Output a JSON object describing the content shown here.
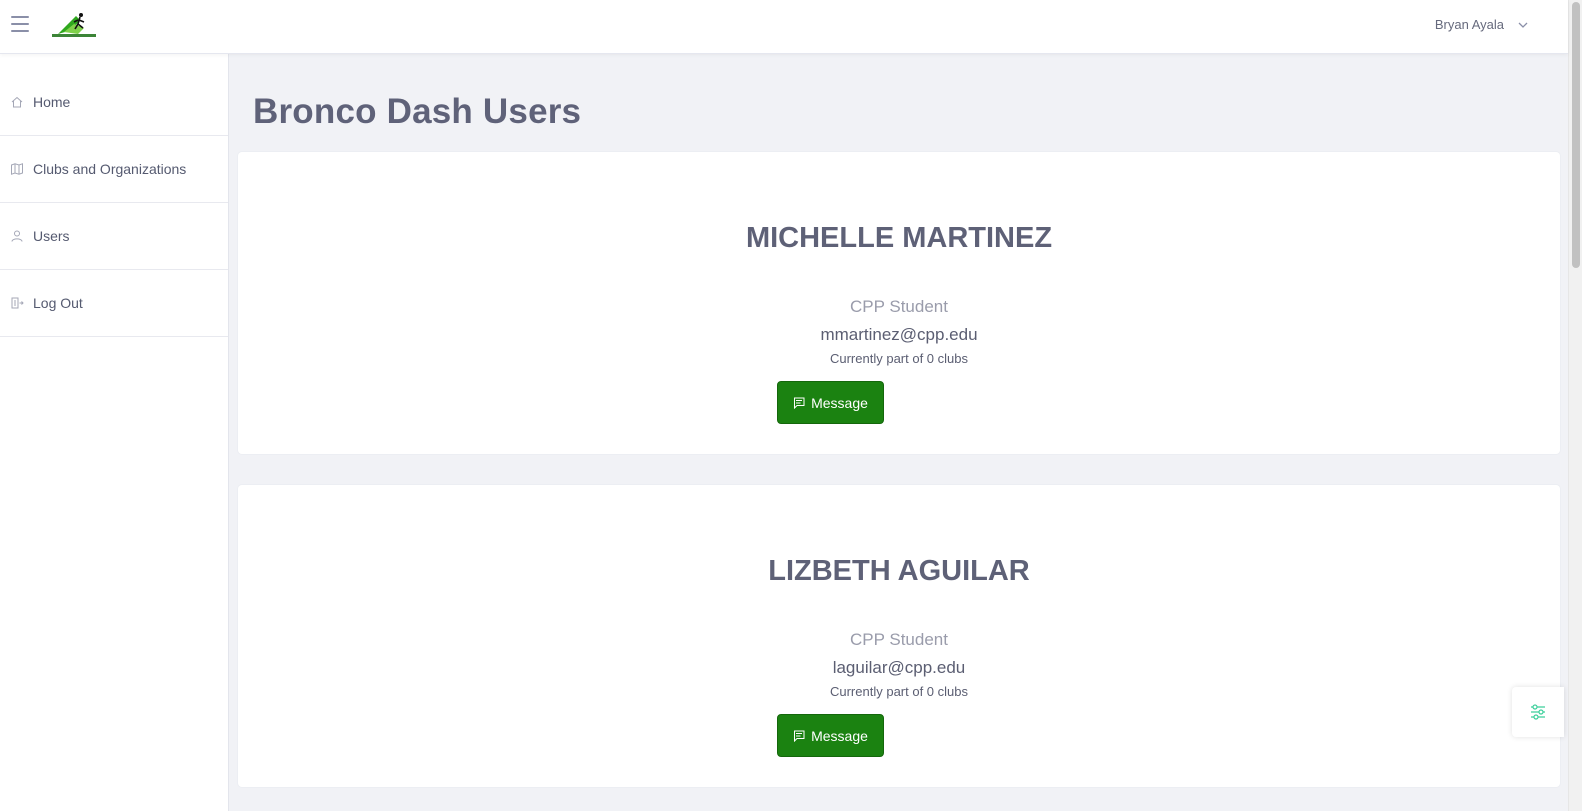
{
  "header": {
    "user_name": "Bryan Ayala",
    "logo_icon": "bronco-dash-logo"
  },
  "sidebar": {
    "items": [
      {
        "label": "Home",
        "icon": "home-icon"
      },
      {
        "label": "Clubs and Organizations",
        "icon": "map-icon"
      },
      {
        "label": "Users",
        "icon": "user-icon"
      },
      {
        "label": "Log Out",
        "icon": "logout-icon"
      }
    ]
  },
  "main": {
    "title": "Bronco Dash Users",
    "users": [
      {
        "name": "MICHELLE MARTINEZ",
        "role": "CPP Student",
        "email": "mmartinez@cpp.edu",
        "clubs": "Currently part of 0 clubs",
        "button_label": "Message"
      },
      {
        "name": "LIZBETH AGUILAR",
        "role": "CPP Student",
        "email": "laguilar@cpp.edu",
        "clubs": "Currently part of 0 clubs",
        "button_label": "Message"
      }
    ]
  },
  "colors": {
    "accent": "#1b8211",
    "title": "#5f6279",
    "background": "#f1f2f6"
  }
}
